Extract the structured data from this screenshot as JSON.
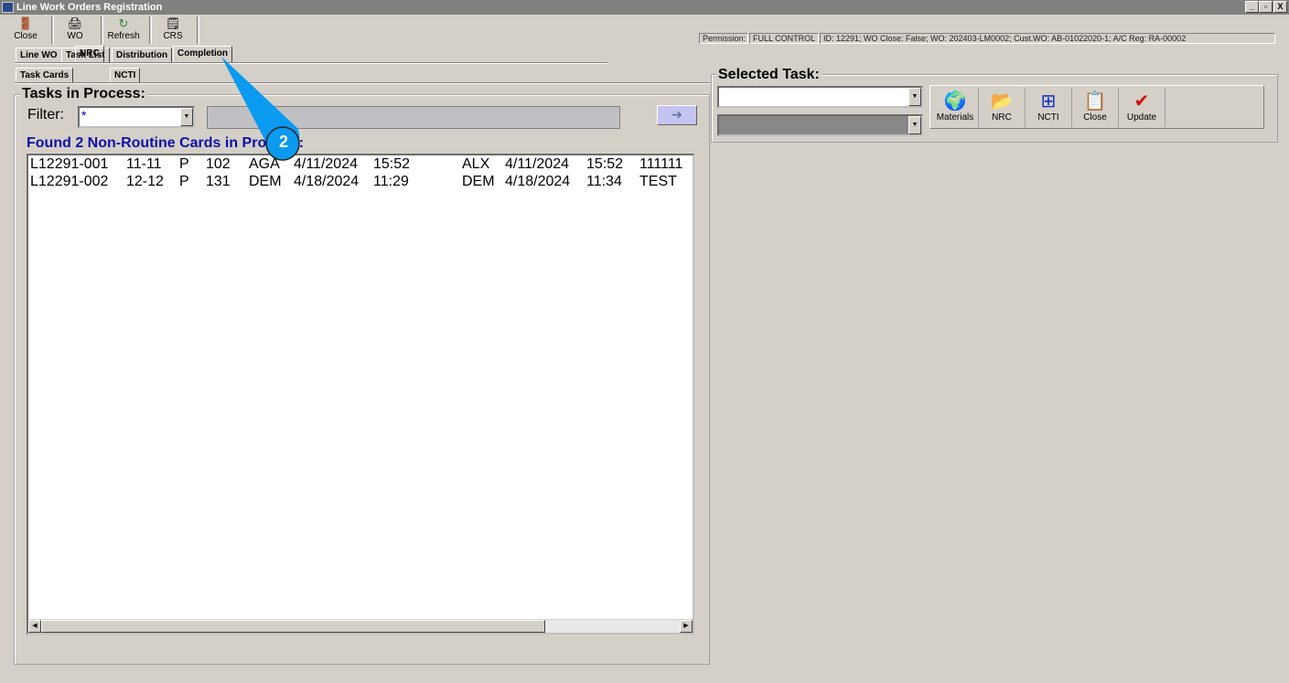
{
  "window": {
    "title": "Line Work Orders Registration",
    "controls": [
      "_",
      "▫",
      "X"
    ]
  },
  "toolbar": [
    {
      "label": "Close",
      "icon": "exit-door-icon"
    },
    {
      "label": "WO",
      "icon": "printer-icon"
    },
    {
      "label": "Refresh",
      "icon": "refresh-icon"
    },
    {
      "label": "CRS",
      "icon": "certificate-icon"
    }
  ],
  "status": {
    "permission_label": "Permission:",
    "permission_value": "FULL CONTROL",
    "info": "ID: 12291; WO Close: False; WO: 202403-LM0002; Cust.WO: AB-01022020-1; A/C Reg: RA-00002"
  },
  "tabs": [
    "Line WO",
    "Task List",
    "Distribution",
    "Completion"
  ],
  "subtabs": [
    "Task Cards",
    "NRC",
    "NCTI"
  ],
  "tasks": {
    "title": "Tasks in Process:",
    "filter_label": "Filter:",
    "filter_value": "*",
    "found_label": "Found 2 Non-Routine Cards in Process:",
    "go_icon": "arrow-right-icon",
    "rows": [
      [
        "L12291-001",
        "11-11",
        "P",
        "102",
        "AGA",
        "4/11/2024",
        "15:52",
        "ALX",
        "4/11/2024",
        "15:52",
        "111111"
      ],
      [
        "L12291-002",
        "12-12",
        "P",
        "131",
        "DEM",
        "4/18/2024",
        "11:29",
        "DEM",
        "4/18/2024",
        "11:34",
        "TEST"
      ]
    ]
  },
  "selected": {
    "title": "Selected Task:",
    "actions": [
      {
        "label": "Materials",
        "icon": "materials-globe-icon"
      },
      {
        "label": "NRC",
        "icon": "folder-documents-icon"
      },
      {
        "label": "NCTI",
        "icon": "import-table-icon"
      },
      {
        "label": "Close",
        "icon": "close-document-icon"
      },
      {
        "label": "Update",
        "icon": "clipboard-check-icon"
      }
    ]
  },
  "annotation": {
    "number": "2",
    "color": "#0a9af0"
  }
}
